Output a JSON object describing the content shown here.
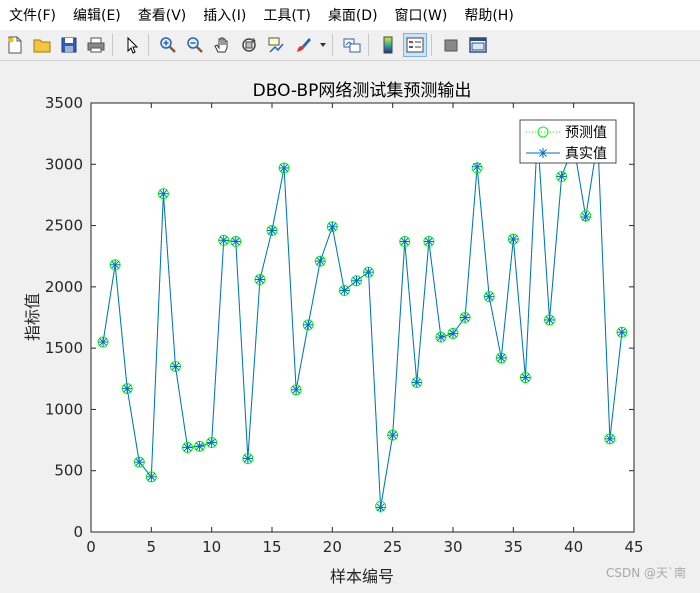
{
  "menu": [
    "文件(F)",
    "编辑(E)",
    "查看(V)",
    "插入(I)",
    "工具(T)",
    "桌面(D)",
    "窗口(W)",
    "帮助(H)"
  ],
  "toolbar": {
    "icons": [
      "new-file-icon",
      "open-folder-icon",
      "save-icon",
      "print-icon",
      "pointer-icon",
      "zoom-in-icon",
      "zoom-out-icon",
      "pan-hand-icon",
      "rotate-3d-icon",
      "data-cursor-icon",
      "brush-icon",
      "link-plot-icon",
      "colorbar-icon",
      "legend-icon",
      "hide-tools-icon",
      "dock-icon"
    ]
  },
  "watermark": "CSDN @天`南",
  "chart_data": {
    "type": "line",
    "title": "DBO-BP网络测试集预测输出",
    "xlabel": "样本编号",
    "ylabel": "指标值",
    "xlim": [
      0,
      45
    ],
    "ylim": [
      0,
      3500
    ],
    "xticks": [
      0,
      5,
      10,
      15,
      20,
      25,
      30,
      35,
      40,
      45
    ],
    "yticks": [
      0,
      500,
      1000,
      1500,
      2000,
      2500,
      3000,
      3500
    ],
    "grid": false,
    "legend_position": "top-right",
    "x": [
      1,
      2,
      3,
      4,
      5,
      6,
      7,
      8,
      9,
      10,
      11,
      12,
      13,
      14,
      15,
      16,
      17,
      18,
      19,
      20,
      21,
      22,
      23,
      24,
      25,
      26,
      27,
      28,
      29,
      30,
      31,
      32,
      33,
      34,
      35,
      36,
      37,
      38,
      39,
      40,
      41,
      42,
      43,
      44
    ],
    "series": [
      {
        "name": "预测值",
        "color": "#00ff00",
        "marker": "circle",
        "line": "dotted",
        "values": [
          1550,
          2180,
          1170,
          570,
          450,
          2760,
          1350,
          690,
          700,
          730,
          2380,
          2370,
          600,
          2060,
          2460,
          2970,
          1160,
          1690,
          2210,
          2490,
          1970,
          2050,
          2120,
          210,
          790,
          2370,
          1220,
          2370,
          1590,
          1620,
          1750,
          2970,
          1920,
          1420,
          2390,
          1260,
          3240,
          1730,
          2900,
          3150,
          2580,
          3200,
          760,
          1630
        ]
      },
      {
        "name": "真实值",
        "color": "#0072bd",
        "marker": "star",
        "line": "solid",
        "values": [
          1550,
          2180,
          1170,
          570,
          450,
          2760,
          1350,
          690,
          700,
          730,
          2380,
          2370,
          600,
          2060,
          2460,
          2970,
          1160,
          1690,
          2210,
          2490,
          1970,
          2050,
          2120,
          200,
          790,
          2370,
          1220,
          2370,
          1590,
          1620,
          1750,
          2980,
          1920,
          1420,
          2390,
          1260,
          3250,
          1730,
          2900,
          3160,
          2570,
          3200,
          760,
          1630
        ]
      }
    ]
  }
}
